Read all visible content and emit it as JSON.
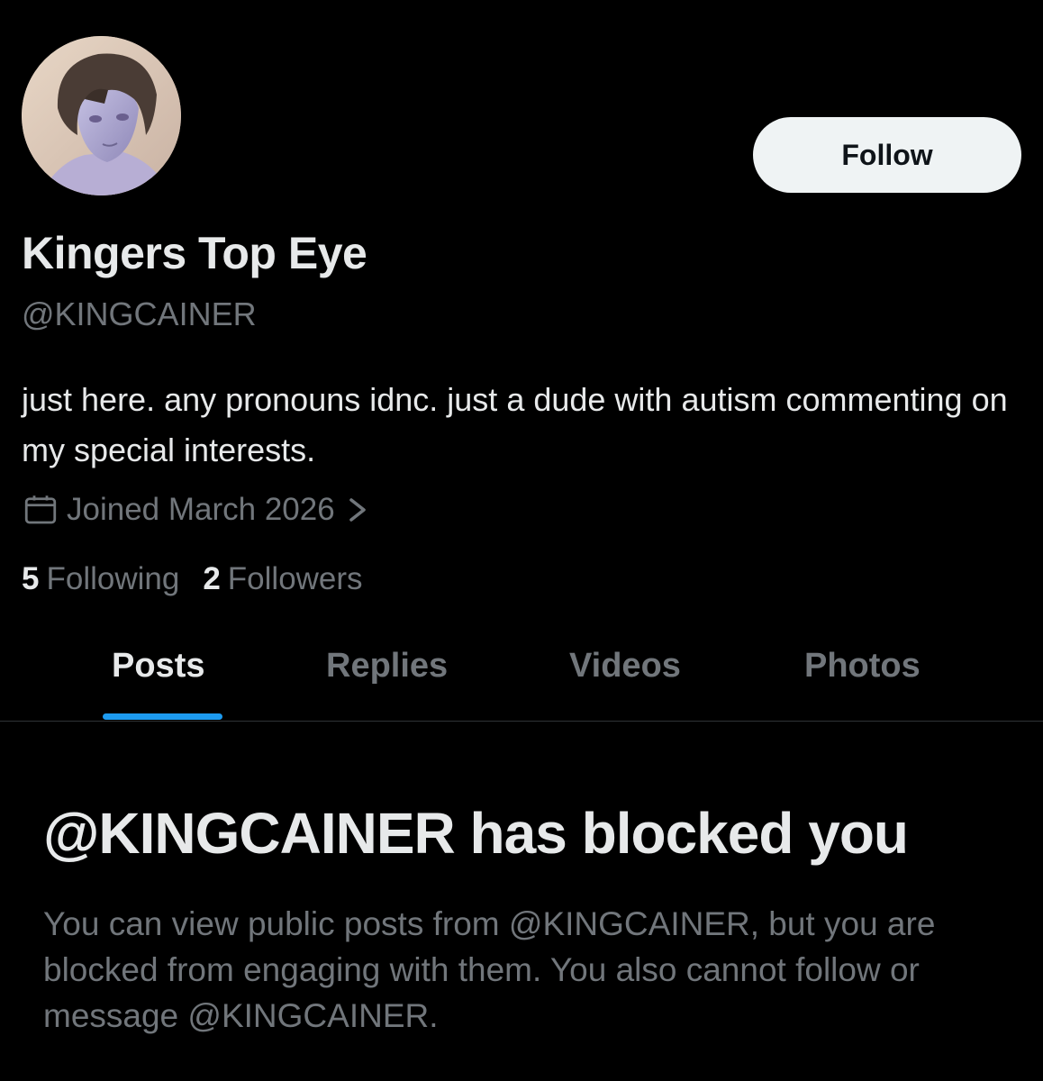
{
  "profile": {
    "display_name": "Kingers Top Eye",
    "handle": "@KINGCAINER",
    "bio": "just here. any pronouns idnc. just a dude with autism commenting on my special interests.",
    "joined": "Joined March 2026",
    "following_count": "5",
    "following_label": "Following",
    "followers_count": "2",
    "followers_label": "Followers",
    "avatar_icon": "anime-avatar"
  },
  "actions": {
    "follow_label": "Follow"
  },
  "tabs": [
    {
      "label": "Posts",
      "active": true
    },
    {
      "label": "Replies",
      "active": false
    },
    {
      "label": "Videos",
      "active": false
    },
    {
      "label": "Photos",
      "active": false
    }
  ],
  "blocked": {
    "title": "@KINGCAINER has blocked you",
    "message": "You can view public posts from @KINGCAINER, but you are blocked from engaging with them. You also cannot follow or message @KINGCAINER."
  },
  "icons": {
    "joined": "calendar-icon",
    "joined_more": "chevron-right-icon"
  },
  "colors": {
    "background": "#000000",
    "primary_text": "#e7e9ea",
    "secondary_text": "#71767b",
    "accent": "#1d9bf0",
    "follow_button_bg": "#eff3f4"
  }
}
